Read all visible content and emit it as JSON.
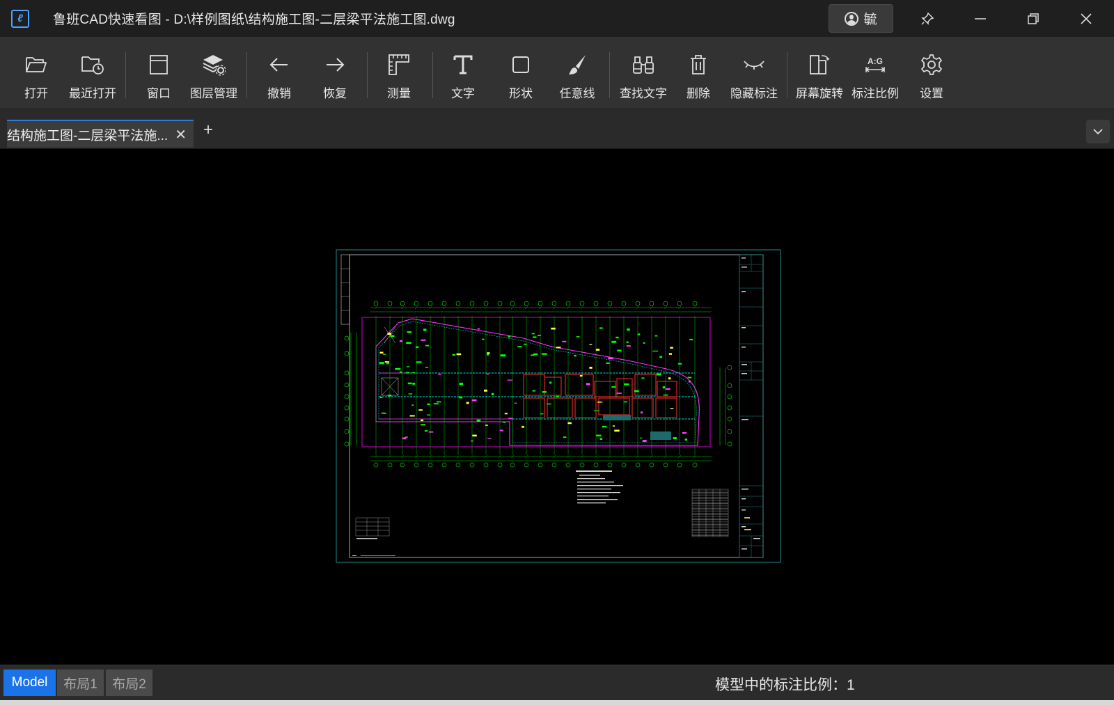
{
  "window": {
    "title": "鲁班CAD快速看图 - D:\\样例图纸\\结构施工图-二层梁平法施工图.dwg",
    "user_name": "毓"
  },
  "toolbar": {
    "items": [
      {
        "label": "打开",
        "icon": "folder-open-icon"
      },
      {
        "label": "最近打开",
        "icon": "folder-clock-icon"
      },
      {
        "label": "窗口",
        "icon": "window-icon"
      },
      {
        "label": "图层管理",
        "icon": "layers-gear-icon"
      },
      {
        "label": "撤销",
        "icon": "arrow-left-icon"
      },
      {
        "label": "恢复",
        "icon": "arrow-right-icon"
      },
      {
        "label": "测量",
        "icon": "ruler-icon"
      },
      {
        "label": "文字",
        "icon": "text-t-icon"
      },
      {
        "label": "形状",
        "icon": "square-icon"
      },
      {
        "label": "任意线",
        "icon": "brush-icon"
      },
      {
        "label": "查找文字",
        "icon": "binoculars-icon"
      },
      {
        "label": "删除",
        "icon": "trash-icon"
      },
      {
        "label": "隐藏标注",
        "icon": "eye-closed-icon"
      },
      {
        "label": "屏幕旋转",
        "icon": "screen-rotate-icon"
      },
      {
        "label": "标注比例",
        "icon": "annotation-scale-icon"
      },
      {
        "label": "设置",
        "icon": "gear-icon"
      }
    ],
    "scale_icon_text": "A:G"
  },
  "tabs": {
    "active_label": "结构施工图-二层梁平法施...",
    "close_symbol": "✕",
    "add_symbol": "+"
  },
  "layouts": [
    "Model",
    "布局1",
    "布局2"
  ],
  "status": {
    "scale_text": "模型中的标注比例：1"
  },
  "colors": {
    "titlebar": "#1f1f1f",
    "toolbar": "#323232",
    "accent": "#1a73e8",
    "canvas": "#000000",
    "cad_green": "#00ff00",
    "cad_magenta": "#ff00ff",
    "cad_cyan": "#00c8c8",
    "cad_red": "#ff3030",
    "cad_yellow": "#ffff00"
  }
}
